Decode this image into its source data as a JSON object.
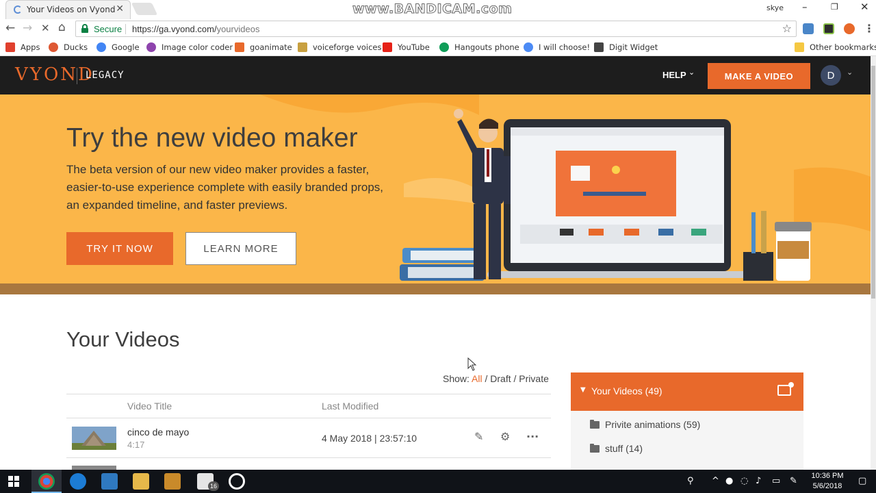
{
  "browser": {
    "tab_title": "Your Videos on Vyond",
    "tab_close": "✕",
    "watermark": "www.BANDICAM.com",
    "window_user": "skye",
    "secure_label": "Secure",
    "url_host": "https://ga.vyond.com/",
    "url_path": "yourvideos",
    "bookmarks": [
      {
        "label": "Apps",
        "color": "#e0402e"
      },
      {
        "label": "Ducks",
        "color": "#de5833"
      },
      {
        "label": "Google",
        "color": "#4285f4"
      },
      {
        "label": "Image color coder",
        "color": "#8e44ad"
      },
      {
        "label": "goanimate",
        "color": "#e8692b"
      },
      {
        "label": "voiceforge voices",
        "color": "#c8a040"
      },
      {
        "label": "YouTube",
        "color": "#e62117"
      },
      {
        "label": "Hangouts phone",
        "color": "#0f9d58"
      },
      {
        "label": "I will choose!",
        "color": "#4c8bf5"
      },
      {
        "label": "Digit Widget",
        "color": "#444444"
      }
    ],
    "other_bookmarks": "Other bookmarks"
  },
  "header": {
    "logo": "VYOND",
    "logo_sub": "LEGACY",
    "help": "HELP",
    "make_video": "MAKE A VIDEO",
    "avatar_initial": "D"
  },
  "banner": {
    "title": "Try the new video maker",
    "description": "The beta version of our new video maker provides a faster, easier-to-use experience complete with easily branded props, an expanded timeline, and faster previews.",
    "try_button": "TRY IT NOW",
    "learn_button": "LEARN MORE"
  },
  "videos": {
    "heading": "Your Videos",
    "show_label": "Show:",
    "filters": [
      "All",
      "Draft",
      "Private"
    ],
    "columns": [
      "Video Title",
      "Last Modified"
    ],
    "rows": [
      {
        "title": "cinco de mayo",
        "duration": "4:17",
        "modified": "4 May 2018 | 23:57:10"
      }
    ]
  },
  "folders": {
    "header": "Your Videos (49)",
    "items": [
      "Privite animations (59)",
      "stuff (14)"
    ]
  },
  "taskbar": {
    "mail_badge": "16",
    "time": "10:36 PM",
    "date": "5/6/2018"
  },
  "colors": {
    "accent": "#e8692b",
    "banner": "#fbb649",
    "header_bg": "#1d1d1d"
  }
}
